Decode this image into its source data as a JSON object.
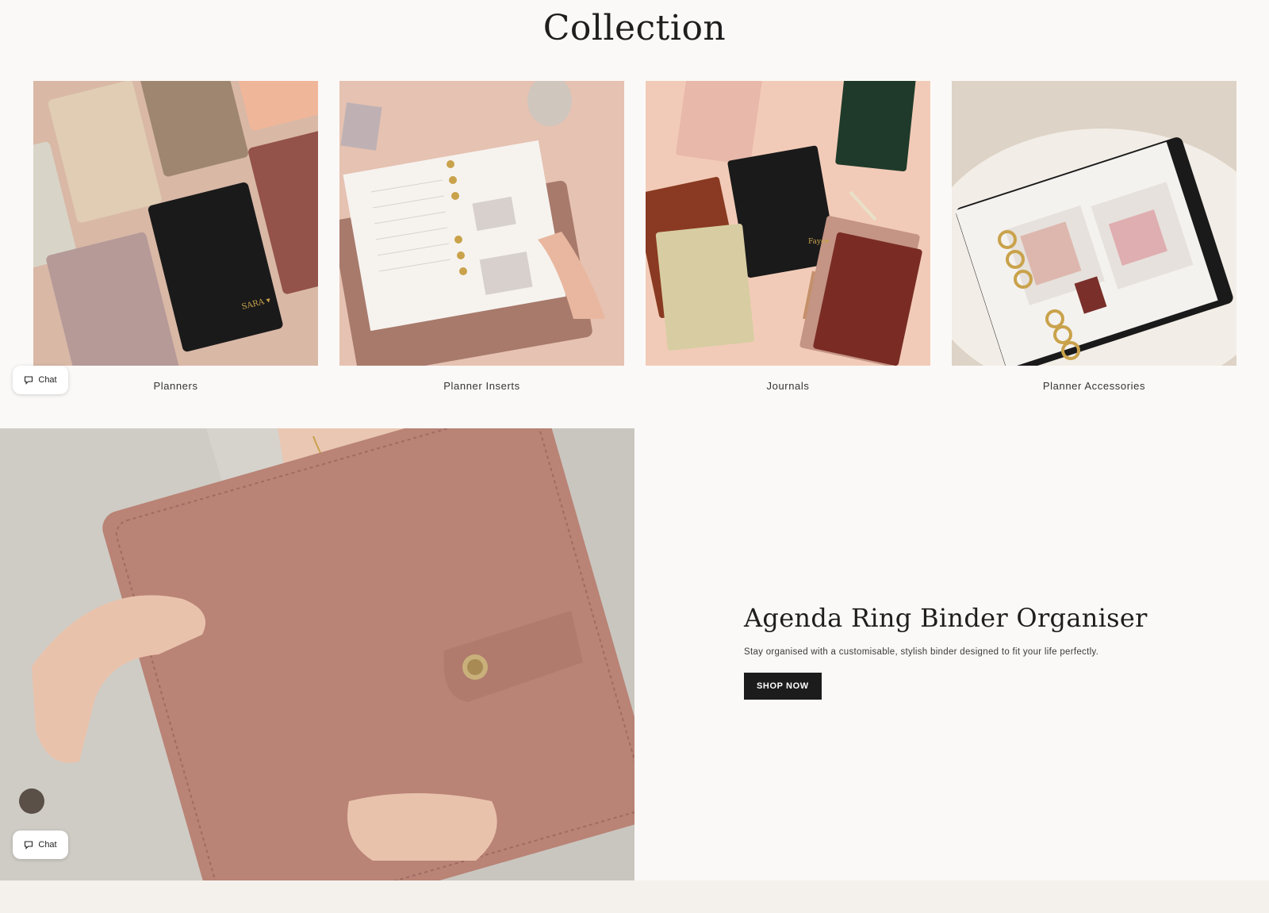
{
  "collection": {
    "title": "Collection",
    "items": [
      {
        "label": "Planners"
      },
      {
        "label": "Planner Inserts"
      },
      {
        "label": "Journals"
      },
      {
        "label": "Planner Accessories"
      }
    ]
  },
  "hero": {
    "title": "Agenda Ring Binder Organiser",
    "subtitle": "Stay organised with a customisable, stylish binder designed to fit your life perfectly.",
    "cta_label": "SHOP NOW"
  },
  "chat": {
    "label": "Chat"
  },
  "colors": {
    "background": "#fbf9f7",
    "button": "#1c1c1c",
    "binder_pink": "#b98376",
    "footer": "#f4f1ec"
  }
}
